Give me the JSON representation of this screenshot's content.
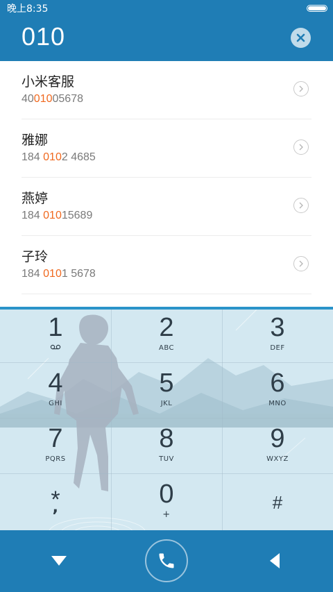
{
  "status_bar": {
    "time": "晚上8:35",
    "battery_icon": "battery-full-icon"
  },
  "dial_input": {
    "value": "010",
    "clear_icon": "clear-x-icon"
  },
  "contacts": [
    {
      "name": "小米客服",
      "number_pre": "40",
      "number_hl": "010",
      "number_post": "05678"
    },
    {
      "name": "雅娜",
      "number_pre": "184 ",
      "number_hl": "010",
      "number_post": "2 4685"
    },
    {
      "name": "燕婷",
      "number_pre": "184 ",
      "number_hl": "010",
      "number_post": "15689"
    },
    {
      "name": "子玲",
      "number_pre": "184 ",
      "number_hl": "010",
      "number_post": "1 5678"
    }
  ],
  "keypad": {
    "keys": [
      {
        "digit": "1",
        "letters": "",
        "icon": "voicemail-icon"
      },
      {
        "digit": "2",
        "letters": "ABC"
      },
      {
        "digit": "3",
        "letters": "DEF"
      },
      {
        "digit": "4",
        "letters": "GHI"
      },
      {
        "digit": "5",
        "letters": "JKL"
      },
      {
        "digit": "6",
        "letters": "MNO"
      },
      {
        "digit": "7",
        "letters": "PQRS"
      },
      {
        "digit": "8",
        "letters": "TUV"
      },
      {
        "digit": "9",
        "letters": "WXYZ"
      },
      {
        "digit": "*",
        "letters": ","
      },
      {
        "digit": "0",
        "letters": "+"
      },
      {
        "digit": "#",
        "letters": ""
      }
    ]
  },
  "bottom_bar": {
    "collapse_icon": "triangle-down-icon",
    "call_icon": "phone-icon",
    "backspace_icon": "triangle-left-icon"
  },
  "colors": {
    "primary": "#1f7db5",
    "highlight": "#f0691f",
    "keypad_bg": "#cfe5ef"
  }
}
